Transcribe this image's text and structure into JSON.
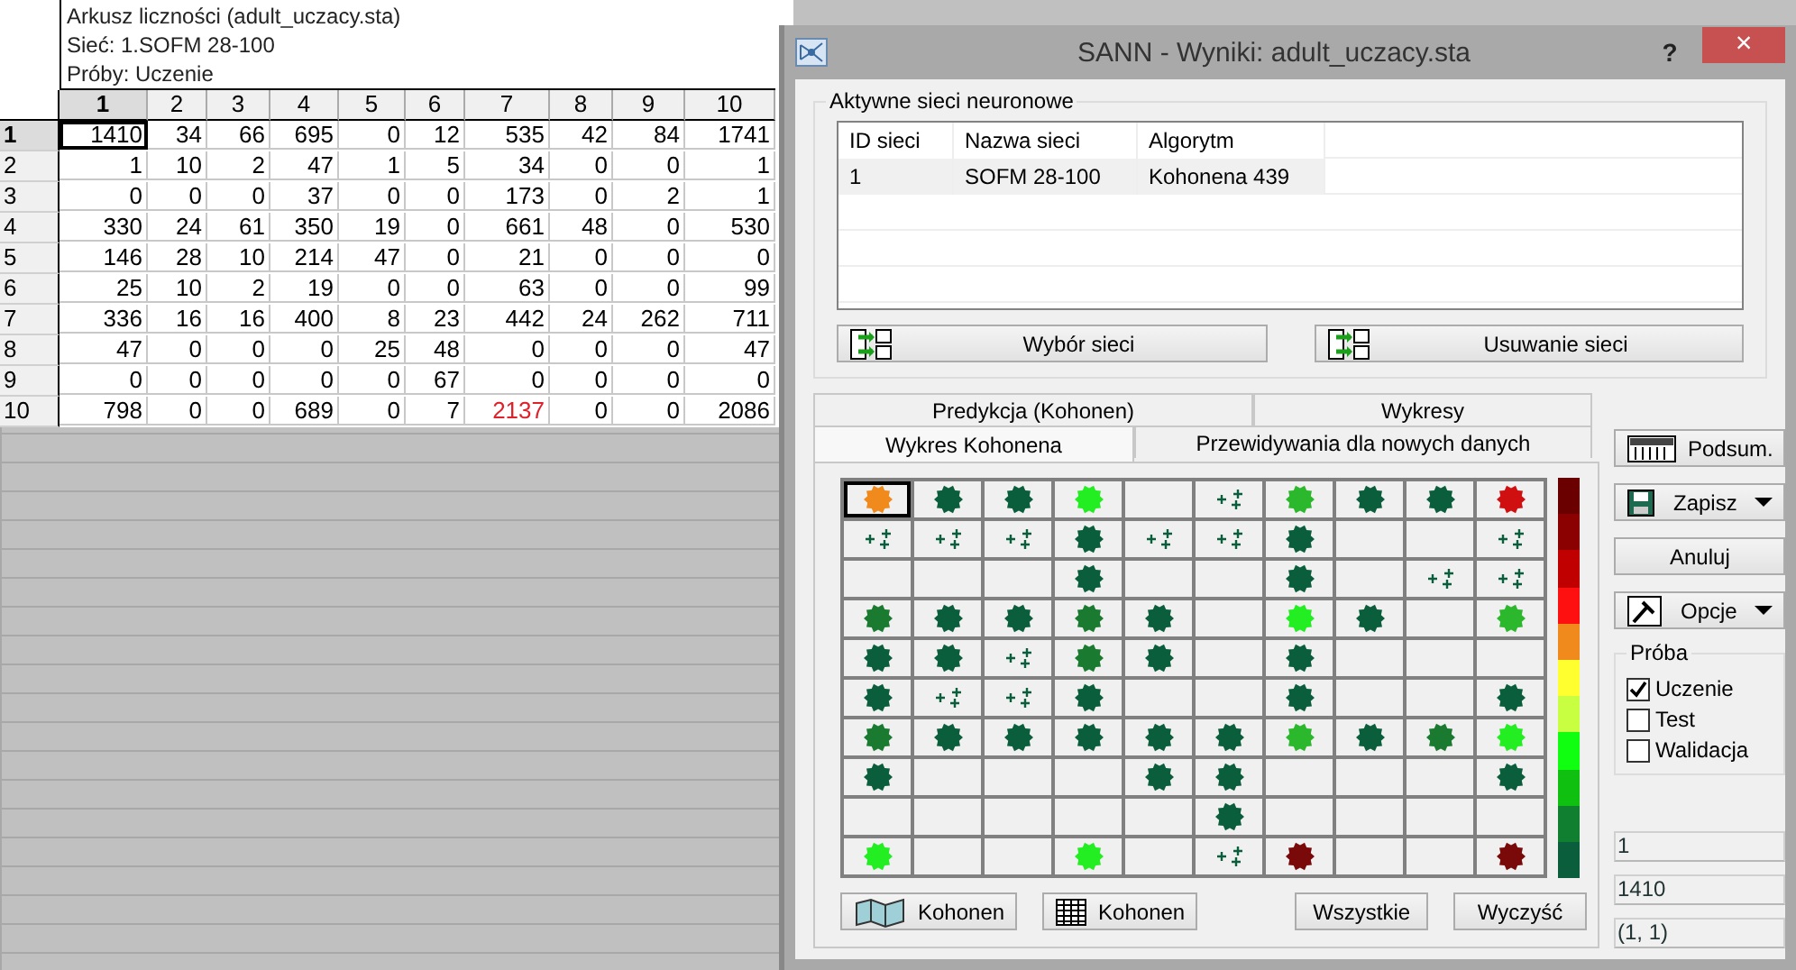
{
  "sheet": {
    "title_lines": [
      "Arkusz liczności (adult_uczacy.sta)",
      "Sieć: 1.SOFM 28-100",
      "Próby: Uczenie"
    ],
    "columns": [
      {
        "label": "1",
        "selected": true
      },
      {
        "label": "2",
        "selected": false
      },
      {
        "label": "3",
        "selected": false
      },
      {
        "label": "4",
        "selected": false
      },
      {
        "label": "5",
        "selected": false
      },
      {
        "label": "6",
        "selected": false
      },
      {
        "label": "7",
        "selected": false
      },
      {
        "label": "8",
        "selected": false
      },
      {
        "label": "9",
        "selected": false
      },
      {
        "label": "10",
        "selected": false
      }
    ],
    "rows": [
      {
        "label": "1",
        "selected": true,
        "cells": [
          {
            "value": "1410",
            "selected": true,
            "flagged": false
          },
          {
            "value": "34",
            "selected": false,
            "flagged": false
          },
          {
            "value": "66",
            "selected": false,
            "flagged": false
          },
          {
            "value": "695",
            "selected": false,
            "flagged": false
          },
          {
            "value": "0",
            "selected": false,
            "flagged": false
          },
          {
            "value": "12",
            "selected": false,
            "flagged": false
          },
          {
            "value": "535",
            "selected": false,
            "flagged": false
          },
          {
            "value": "42",
            "selected": false,
            "flagged": false
          },
          {
            "value": "84",
            "selected": false,
            "flagged": false
          },
          {
            "value": "1741",
            "selected": false,
            "flagged": false
          }
        ]
      },
      {
        "label": "2",
        "selected": false,
        "cells": [
          {
            "value": "1",
            "selected": false,
            "flagged": false
          },
          {
            "value": "10",
            "selected": false,
            "flagged": false
          },
          {
            "value": "2",
            "selected": false,
            "flagged": false
          },
          {
            "value": "47",
            "selected": false,
            "flagged": false
          },
          {
            "value": "1",
            "selected": false,
            "flagged": false
          },
          {
            "value": "5",
            "selected": false,
            "flagged": false
          },
          {
            "value": "34",
            "selected": false,
            "flagged": false
          },
          {
            "value": "0",
            "selected": false,
            "flagged": false
          },
          {
            "value": "0",
            "selected": false,
            "flagged": false
          },
          {
            "value": "1",
            "selected": false,
            "flagged": false
          }
        ]
      },
      {
        "label": "3",
        "selected": false,
        "cells": [
          {
            "value": "0",
            "selected": false,
            "flagged": false
          },
          {
            "value": "0",
            "selected": false,
            "flagged": false
          },
          {
            "value": "0",
            "selected": false,
            "flagged": false
          },
          {
            "value": "37",
            "selected": false,
            "flagged": false
          },
          {
            "value": "0",
            "selected": false,
            "flagged": false
          },
          {
            "value": "0",
            "selected": false,
            "flagged": false
          },
          {
            "value": "173",
            "selected": false,
            "flagged": false
          },
          {
            "value": "0",
            "selected": false,
            "flagged": false
          },
          {
            "value": "2",
            "selected": false,
            "flagged": false
          },
          {
            "value": "1",
            "selected": false,
            "flagged": false
          }
        ]
      },
      {
        "label": "4",
        "selected": false,
        "cells": [
          {
            "value": "330",
            "selected": false,
            "flagged": false
          },
          {
            "value": "24",
            "selected": false,
            "flagged": false
          },
          {
            "value": "61",
            "selected": false,
            "flagged": false
          },
          {
            "value": "350",
            "selected": false,
            "flagged": false
          },
          {
            "value": "19",
            "selected": false,
            "flagged": false
          },
          {
            "value": "0",
            "selected": false,
            "flagged": false
          },
          {
            "value": "661",
            "selected": false,
            "flagged": false
          },
          {
            "value": "48",
            "selected": false,
            "flagged": false
          },
          {
            "value": "0",
            "selected": false,
            "flagged": false
          },
          {
            "value": "530",
            "selected": false,
            "flagged": false
          }
        ]
      },
      {
        "label": "5",
        "selected": false,
        "cells": [
          {
            "value": "146",
            "selected": false,
            "flagged": false
          },
          {
            "value": "28",
            "selected": false,
            "flagged": false
          },
          {
            "value": "10",
            "selected": false,
            "flagged": false
          },
          {
            "value": "214",
            "selected": false,
            "flagged": false
          },
          {
            "value": "47",
            "selected": false,
            "flagged": false
          },
          {
            "value": "0",
            "selected": false,
            "flagged": false
          },
          {
            "value": "21",
            "selected": false,
            "flagged": false
          },
          {
            "value": "0",
            "selected": false,
            "flagged": false
          },
          {
            "value": "0",
            "selected": false,
            "flagged": false
          },
          {
            "value": "0",
            "selected": false,
            "flagged": false
          }
        ]
      },
      {
        "label": "6",
        "selected": false,
        "cells": [
          {
            "value": "25",
            "selected": false,
            "flagged": false
          },
          {
            "value": "10",
            "selected": false,
            "flagged": false
          },
          {
            "value": "2",
            "selected": false,
            "flagged": false
          },
          {
            "value": "19",
            "selected": false,
            "flagged": false
          },
          {
            "value": "0",
            "selected": false,
            "flagged": false
          },
          {
            "value": "0",
            "selected": false,
            "flagged": false
          },
          {
            "value": "63",
            "selected": false,
            "flagged": false
          },
          {
            "value": "0",
            "selected": false,
            "flagged": false
          },
          {
            "value": "0",
            "selected": false,
            "flagged": false
          },
          {
            "value": "99",
            "selected": false,
            "flagged": false
          }
        ]
      },
      {
        "label": "7",
        "selected": false,
        "cells": [
          {
            "value": "336",
            "selected": false,
            "flagged": false
          },
          {
            "value": "16",
            "selected": false,
            "flagged": false
          },
          {
            "value": "16",
            "selected": false,
            "flagged": false
          },
          {
            "value": "400",
            "selected": false,
            "flagged": false
          },
          {
            "value": "8",
            "selected": false,
            "flagged": false
          },
          {
            "value": "23",
            "selected": false,
            "flagged": false
          },
          {
            "value": "442",
            "selected": false,
            "flagged": false
          },
          {
            "value": "24",
            "selected": false,
            "flagged": false
          },
          {
            "value": "262",
            "selected": false,
            "flagged": false
          },
          {
            "value": "711",
            "selected": false,
            "flagged": false
          }
        ]
      },
      {
        "label": "8",
        "selected": false,
        "cells": [
          {
            "value": "47",
            "selected": false,
            "flagged": false
          },
          {
            "value": "0",
            "selected": false,
            "flagged": false
          },
          {
            "value": "0",
            "selected": false,
            "flagged": false
          },
          {
            "value": "0",
            "selected": false,
            "flagged": false
          },
          {
            "value": "25",
            "selected": false,
            "flagged": false
          },
          {
            "value": "48",
            "selected": false,
            "flagged": false
          },
          {
            "value": "0",
            "selected": false,
            "flagged": false
          },
          {
            "value": "0",
            "selected": false,
            "flagged": false
          },
          {
            "value": "0",
            "selected": false,
            "flagged": false
          },
          {
            "value": "47",
            "selected": false,
            "flagged": false
          }
        ]
      },
      {
        "label": "9",
        "selected": false,
        "cells": [
          {
            "value": "0",
            "selected": false,
            "flagged": false
          },
          {
            "value": "0",
            "selected": false,
            "flagged": false
          },
          {
            "value": "0",
            "selected": false,
            "flagged": false
          },
          {
            "value": "0",
            "selected": false,
            "flagged": false
          },
          {
            "value": "0",
            "selected": false,
            "flagged": false
          },
          {
            "value": "67",
            "selected": false,
            "flagged": false
          },
          {
            "value": "0",
            "selected": false,
            "flagged": false
          },
          {
            "value": "0",
            "selected": false,
            "flagged": false
          },
          {
            "value": "0",
            "selected": false,
            "flagged": false
          },
          {
            "value": "0",
            "selected": false,
            "flagged": false
          }
        ]
      },
      {
        "label": "10",
        "selected": false,
        "cells": [
          {
            "value": "798",
            "selected": false,
            "flagged": false
          },
          {
            "value": "0",
            "selected": false,
            "flagged": false
          },
          {
            "value": "0",
            "selected": false,
            "flagged": false
          },
          {
            "value": "689",
            "selected": false,
            "flagged": false
          },
          {
            "value": "0",
            "selected": false,
            "flagged": false
          },
          {
            "value": "7",
            "selected": false,
            "flagged": false
          },
          {
            "value": "2137",
            "selected": false,
            "flagged": true
          },
          {
            "value": "0",
            "selected": false,
            "flagged": false
          },
          {
            "value": "0",
            "selected": false,
            "flagged": false
          },
          {
            "value": "2086",
            "selected": false,
            "flagged": false
          }
        ]
      }
    ]
  },
  "dialog": {
    "title": "SANN - Wyniki: adult_uczacy.sta",
    "help": "?",
    "close": "×",
    "networks_group": {
      "label": "Aktywne sieci neuronowe",
      "columns": [
        "ID sieci",
        "Nazwa sieci",
        "Algorytm"
      ],
      "rows": [
        {
          "cells": [
            "1",
            "SOFM 28-100",
            "Kohonena 439"
          ],
          "selected": true
        }
      ],
      "buttons": [
        "Wybór sieci",
        "Usuwanie sieci"
      ]
    },
    "tab_rows": [
      [
        {
          "label": "Predykcja (Kohonen)",
          "selected": false
        },
        {
          "label": "Wykresy",
          "selected": false
        }
      ],
      [
        {
          "label": "Wykres Kohonena",
          "selected": true
        },
        {
          "label": "Przewidywania dla nowych danych",
          "selected": false
        }
      ]
    ],
    "kohonen_map": {
      "rows": [
        [
          {
            "kind": "blob",
            "color": "#f08a1c",
            "selected": true
          },
          {
            "kind": "blob",
            "color": "#0b5e3c",
            "selected": false
          },
          {
            "kind": "blob",
            "color": "#0b5e3c",
            "selected": false
          },
          {
            "kind": "blob",
            "color": "#22ee22",
            "selected": false
          },
          {
            "kind": "empty",
            "selected": false
          },
          {
            "kind": "sparse",
            "color": "#0b5e3c",
            "selected": false
          },
          {
            "kind": "blob",
            "color": "#2cb82c",
            "selected": false
          },
          {
            "kind": "blob",
            "color": "#0b5e3c",
            "selected": false
          },
          {
            "kind": "blob",
            "color": "#0b5e3c",
            "selected": false
          },
          {
            "kind": "blob",
            "color": "#d01010",
            "selected": false
          }
        ],
        [
          {
            "kind": "sparse",
            "color": "#0b5e3c",
            "selected": false
          },
          {
            "kind": "sparse",
            "color": "#0b5e3c",
            "selected": false
          },
          {
            "kind": "sparse",
            "color": "#0b5e3c",
            "selected": false
          },
          {
            "kind": "blob",
            "color": "#0b5e3c",
            "selected": false
          },
          {
            "kind": "sparse",
            "color": "#0b5e3c",
            "selected": false
          },
          {
            "kind": "sparse",
            "color": "#0b5e3c",
            "selected": false
          },
          {
            "kind": "blob",
            "color": "#0b5e3c",
            "selected": false
          },
          {
            "kind": "empty",
            "selected": false
          },
          {
            "kind": "empty",
            "selected": false
          },
          {
            "kind": "sparse",
            "color": "#0b5e3c",
            "selected": false
          }
        ],
        [
          {
            "kind": "empty",
            "selected": false
          },
          {
            "kind": "empty",
            "selected": false
          },
          {
            "kind": "empty",
            "selected": false
          },
          {
            "kind": "blob",
            "color": "#0b5e3c",
            "selected": false
          },
          {
            "kind": "empty",
            "selected": false
          },
          {
            "kind": "empty",
            "selected": false
          },
          {
            "kind": "blob",
            "color": "#0b5e3c",
            "selected": false
          },
          {
            "kind": "empty",
            "selected": false
          },
          {
            "kind": "sparse",
            "color": "#0b5e3c",
            "selected": false
          },
          {
            "kind": "sparse",
            "color": "#0b5e3c",
            "selected": false
          }
        ],
        [
          {
            "kind": "blob",
            "color": "#1a7a30",
            "selected": false
          },
          {
            "kind": "blob",
            "color": "#0b5e3c",
            "selected": false
          },
          {
            "kind": "blob",
            "color": "#0b5e3c",
            "selected": false
          },
          {
            "kind": "blob",
            "color": "#1a7a30",
            "selected": false
          },
          {
            "kind": "blob",
            "color": "#0b5e3c",
            "selected": false
          },
          {
            "kind": "empty",
            "selected": false
          },
          {
            "kind": "blob",
            "color": "#22ee22",
            "selected": false
          },
          {
            "kind": "blob",
            "color": "#0b5e3c",
            "selected": false
          },
          {
            "kind": "empty",
            "selected": false
          },
          {
            "kind": "blob",
            "color": "#2cb82c",
            "selected": false
          }
        ],
        [
          {
            "kind": "blob",
            "color": "#0b5e3c",
            "selected": false
          },
          {
            "kind": "blob",
            "color": "#0b5e3c",
            "selected": false
          },
          {
            "kind": "sparse",
            "color": "#0b5e3c",
            "selected": false
          },
          {
            "kind": "blob",
            "color": "#1a7a30",
            "selected": false
          },
          {
            "kind": "blob",
            "color": "#0b5e3c",
            "selected": false
          },
          {
            "kind": "empty",
            "selected": false
          },
          {
            "kind": "blob",
            "color": "#0b5e3c",
            "selected": false
          },
          {
            "kind": "empty",
            "selected": false
          },
          {
            "kind": "empty",
            "selected": false
          },
          {
            "kind": "empty",
            "selected": false
          }
        ],
        [
          {
            "kind": "blob",
            "color": "#0b5e3c",
            "selected": false
          },
          {
            "kind": "sparse",
            "color": "#0b5e3c",
            "selected": false
          },
          {
            "kind": "sparse",
            "color": "#0b5e3c",
            "selected": false
          },
          {
            "kind": "blob",
            "color": "#0b5e3c",
            "selected": false
          },
          {
            "kind": "empty",
            "selected": false
          },
          {
            "kind": "empty",
            "selected": false
          },
          {
            "kind": "blob",
            "color": "#0b5e3c",
            "selected": false
          },
          {
            "kind": "empty",
            "selected": false
          },
          {
            "kind": "empty",
            "selected": false
          },
          {
            "kind": "blob",
            "color": "#0b5e3c",
            "selected": false
          }
        ],
        [
          {
            "kind": "blob",
            "color": "#1a7a30",
            "selected": false
          },
          {
            "kind": "blob",
            "color": "#0b5e3c",
            "selected": false
          },
          {
            "kind": "blob",
            "color": "#0b5e3c",
            "selected": false
          },
          {
            "kind": "blob",
            "color": "#0b5e3c",
            "selected": false
          },
          {
            "kind": "blob",
            "color": "#0b5e3c",
            "selected": false
          },
          {
            "kind": "blob",
            "color": "#0b5e3c",
            "selected": false
          },
          {
            "kind": "blob",
            "color": "#2cb82c",
            "selected": false
          },
          {
            "kind": "blob",
            "color": "#0b5e3c",
            "selected": false
          },
          {
            "kind": "blob",
            "color": "#1a7a30",
            "selected": false
          },
          {
            "kind": "blob",
            "color": "#22ee22",
            "selected": false
          }
        ],
        [
          {
            "kind": "blob",
            "color": "#0b5e3c",
            "selected": false
          },
          {
            "kind": "empty",
            "selected": false
          },
          {
            "kind": "empty",
            "selected": false
          },
          {
            "kind": "empty",
            "selected": false
          },
          {
            "kind": "blob",
            "color": "#0b5e3c",
            "selected": false
          },
          {
            "kind": "blob",
            "color": "#0b5e3c",
            "selected": false
          },
          {
            "kind": "empty",
            "selected": false
          },
          {
            "kind": "empty",
            "selected": false
          },
          {
            "kind": "empty",
            "selected": false
          },
          {
            "kind": "blob",
            "color": "#0b5e3c",
            "selected": false
          }
        ],
        [
          {
            "kind": "empty",
            "selected": false
          },
          {
            "kind": "empty",
            "selected": false
          },
          {
            "kind": "empty",
            "selected": false
          },
          {
            "kind": "empty",
            "selected": false
          },
          {
            "kind": "empty",
            "selected": false
          },
          {
            "kind": "blob",
            "color": "#0b5e3c",
            "selected": false
          },
          {
            "kind": "empty",
            "selected": false
          },
          {
            "kind": "empty",
            "selected": false
          },
          {
            "kind": "empty",
            "selected": false
          },
          {
            "kind": "empty",
            "selected": false
          }
        ],
        [
          {
            "kind": "blob",
            "color": "#22ee22",
            "selected": false
          },
          {
            "kind": "empty",
            "selected": false
          },
          {
            "kind": "empty",
            "selected": false
          },
          {
            "kind": "blob",
            "color": "#22ee22",
            "selected": false
          },
          {
            "kind": "empty",
            "selected": false
          },
          {
            "kind": "sparse",
            "color": "#0b5e3c",
            "selected": false
          },
          {
            "kind": "blob",
            "color": "#7a0a0a",
            "selected": false
          },
          {
            "kind": "empty",
            "selected": false
          },
          {
            "kind": "empty",
            "selected": false
          },
          {
            "kind": "blob",
            "color": "#7a0a0a",
            "selected": false
          }
        ]
      ]
    },
    "map_buttons": [
      {
        "label": "Kohonen",
        "kind": "map"
      },
      {
        "label": "Kohonen",
        "kind": "table"
      },
      {
        "label": "Wszystkie",
        "kind": "plain"
      },
      {
        "label": "Wyczyść",
        "kind": "plain"
      }
    ],
    "side_buttons": [
      {
        "label": "Podsum.",
        "kind": "summary"
      },
      {
        "label": "Zapisz",
        "kind": "save"
      },
      {
        "label": "Anuluj",
        "kind": "plain"
      },
      {
        "label": "Opcje",
        "kind": "options"
      }
    ],
    "sample_group": {
      "label": "Próba",
      "options": [
        {
          "label": "Uczenie",
          "checked": true
        },
        {
          "label": "Test",
          "checked": false
        },
        {
          "label": "Walidacja",
          "checked": false
        }
      ]
    },
    "readouts": [
      "1",
      "1410",
      "(1, 1)"
    ]
  }
}
